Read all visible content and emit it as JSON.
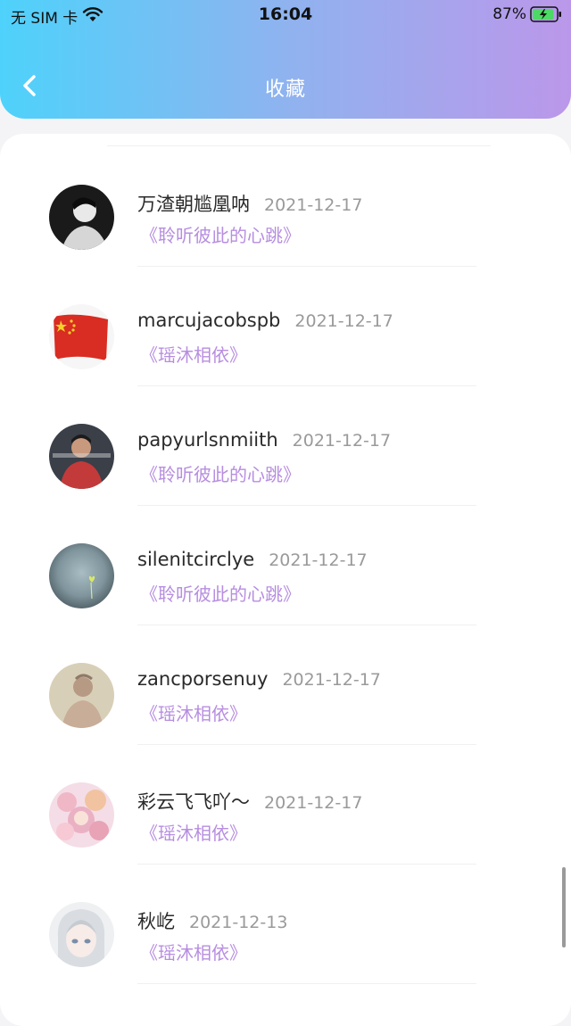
{
  "status_bar": {
    "carrier": "无 SIM 卡",
    "time": "16:04",
    "battery_percent": "87%"
  },
  "nav": {
    "back_icon": "chevron-left-icon",
    "title": "收藏"
  },
  "favorites": [
    {
      "name": "万渣朝尴凰呐",
      "date": "2021-12-17",
      "work": "《聆听彼此的心跳》",
      "avatar": "dark-portrait"
    },
    {
      "name": "marcujacobspb",
      "date": "2021-12-17",
      "work": "《瑶沐相依》",
      "avatar": "flag"
    },
    {
      "name": "papyurlsnmiith",
      "date": "2021-12-17",
      "work": "《聆听彼此的心跳》",
      "avatar": "person-red"
    },
    {
      "name": "silenitcirclye",
      "date": "2021-12-17",
      "work": "《聆听彼此的心跳》",
      "avatar": "misty"
    },
    {
      "name": "zancporsenuy",
      "date": "2021-12-17",
      "work": "《瑶沐相依》",
      "avatar": "beige-portrait"
    },
    {
      "name": "彩云飞飞吖～",
      "date": "2021-12-17",
      "work": "《瑶沐相依》",
      "avatar": "pink-floral"
    },
    {
      "name": "秋屹",
      "date": "2021-12-13",
      "work": "《瑶沐相依》",
      "avatar": "anime"
    }
  ],
  "colors": {
    "header_gradient": [
      "#4ed2fb",
      "#8fb3ef",
      "#bb97ea"
    ],
    "work_title": "#b78ee0",
    "date": "#9a9a9a"
  }
}
